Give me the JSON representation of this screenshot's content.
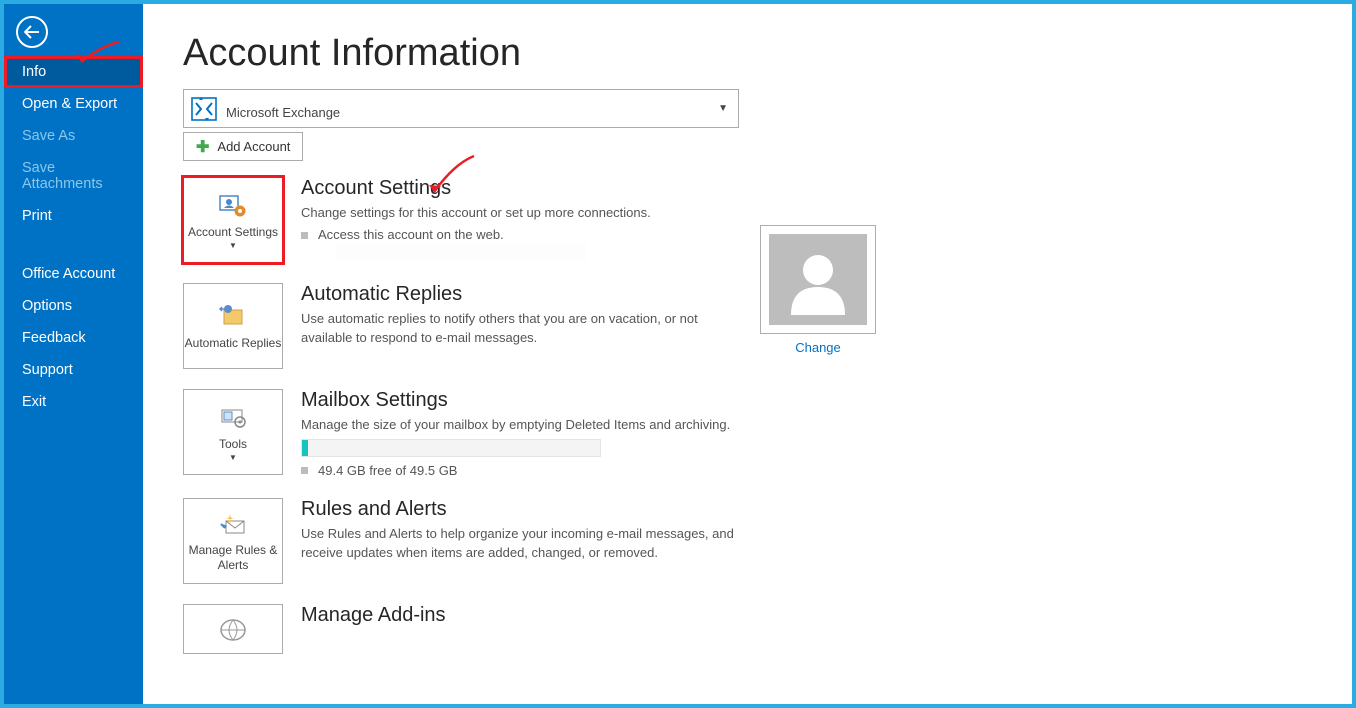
{
  "sidebar": {
    "items": [
      {
        "label": "Info",
        "selected": true,
        "highlight": true
      },
      {
        "label": "Open & Export"
      },
      {
        "label": "Save As",
        "disabled": true
      },
      {
        "label": "Save Attachments",
        "disabled": true
      },
      {
        "label": "Print"
      }
    ],
    "items2": [
      {
        "label": "Office Account"
      },
      {
        "label": "Options"
      },
      {
        "label": "Feedback"
      },
      {
        "label": "Support"
      },
      {
        "label": "Exit"
      }
    ]
  },
  "main": {
    "title": "Account Information",
    "account_type": "Microsoft Exchange",
    "add_account": "Add Account",
    "avatar_change": "Change",
    "sections": {
      "account_settings": {
        "btn": "Account Settings",
        "title": "Account Settings",
        "desc": "Change settings for this account or set up more connections.",
        "bullet": "Access this account on the web."
      },
      "auto_replies": {
        "btn": "Automatic Replies",
        "title": "Automatic Replies",
        "desc": "Use automatic replies to notify others that you are on vacation, or not available to respond to e-mail messages."
      },
      "mailbox": {
        "btn": "Tools",
        "title": "Mailbox Settings",
        "desc": "Manage the size of your mailbox by emptying Deleted Items and archiving.",
        "storage": "49.4 GB free of 49.5 GB"
      },
      "rules": {
        "btn": "Manage Rules & Alerts",
        "title": "Rules and Alerts",
        "desc": "Use Rules and Alerts to help organize your incoming e-mail messages, and receive updates when items are added, changed, or removed."
      },
      "addins": {
        "title": "Manage Add-ins"
      }
    }
  }
}
